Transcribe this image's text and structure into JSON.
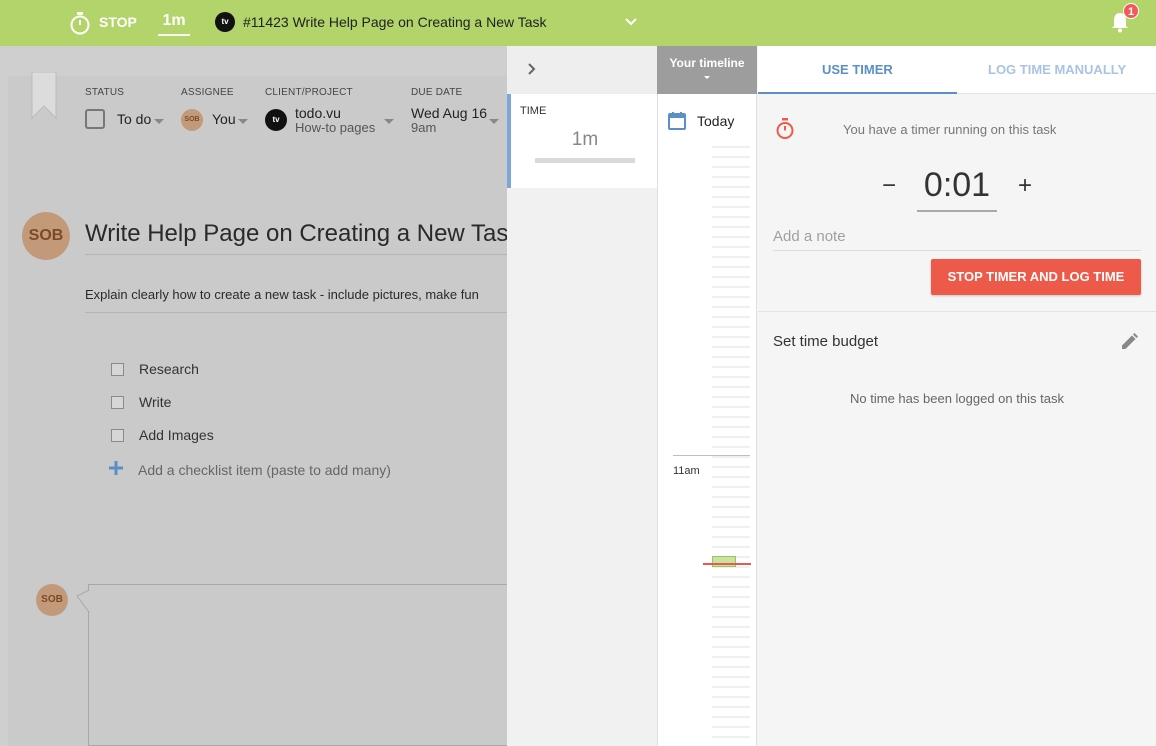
{
  "topbar": {
    "stop_label": "STOP",
    "elapsed": "1m",
    "client_badge": "tv",
    "task_title": "#11423  Write Help Page on Creating a New Task",
    "notification_count": "1",
    "accent_color": "#b2d46a"
  },
  "task": {
    "fields": {
      "status_label": "STATUS",
      "status_value": "To do",
      "assignee_label": "ASSIGNEE",
      "assignee_initials": "SOB",
      "assignee_value": "You",
      "client_label": "CLIENT/PROJECT",
      "client_badge": "tv",
      "client_value": "todo.vu",
      "project_value": "How-to pages",
      "due_label": "DUE DATE",
      "due_date": "Wed Aug 16",
      "due_time": "9am"
    },
    "avatar_initials": "SOB",
    "title": "Write Help Page on Creating a New Task",
    "description": "Explain clearly how to create a new task - include pictures, make fun",
    "checklist": [
      "Research",
      "Write",
      "Add Images"
    ],
    "add_checklist_placeholder": "Add a checklist item (paste to add many)",
    "comment_avatar": "SOB"
  },
  "panel": {
    "time_label": "TIME",
    "time_value": "1m",
    "timeline_title": "Your timeline",
    "today_label": "Today",
    "hour_label": "11am",
    "tabs": {
      "use_timer": "USE TIMER",
      "log_manually": "LOG TIME MANUALLY"
    },
    "running_text": "You have a timer running on this task",
    "timer_value": "0:01",
    "minus": "−",
    "plus": "+",
    "note_placeholder": "Add a note",
    "stop_button": "STOP TIMER AND LOG TIME",
    "budget_label": "Set time budget",
    "no_time_text": "No time has been logged on this task",
    "stop_button_color": "#ee5a4a",
    "tab_active_color": "#5b8fc7"
  }
}
